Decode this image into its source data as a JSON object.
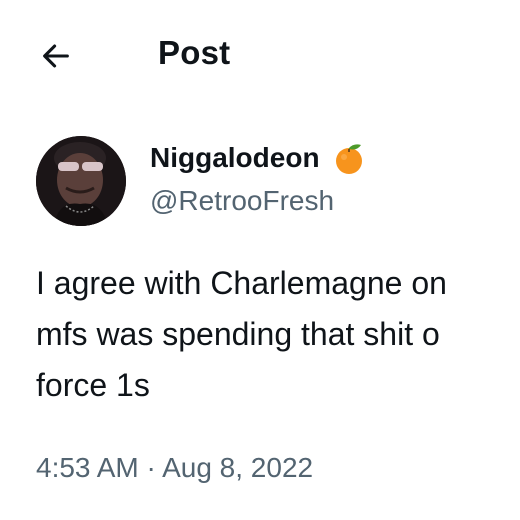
{
  "header": {
    "back_icon": "arrow-left-icon",
    "title": "Post"
  },
  "post": {
    "author": {
      "display_name": "Niggalodeon",
      "badge_icon": "orange-fruit-icon",
      "handle": "@RetrooFresh",
      "avatar_icon": "avatar-photo"
    },
    "text_lines": [
      "I agree with Charlemagne on",
      "mfs was spending that shit o",
      "force 1s"
    ],
    "timestamp": "4:53 AM · Aug 8, 2022"
  },
  "colors": {
    "primary_text": "#0f1419",
    "secondary_text": "#536471",
    "background": "#ffffff",
    "badge_orange": "#f7941d"
  }
}
